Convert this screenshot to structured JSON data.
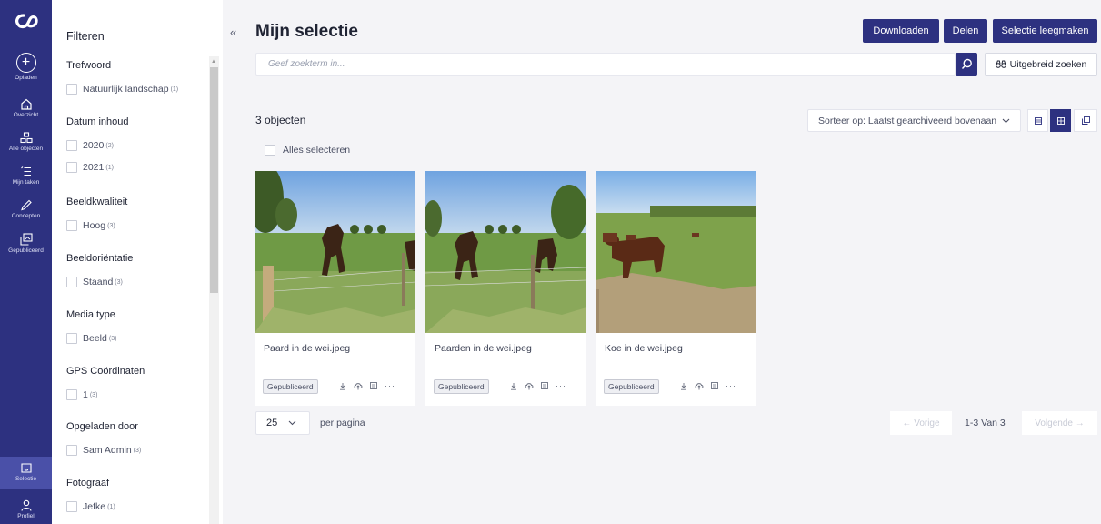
{
  "nav": {
    "upload": "Opladen",
    "overview": "Overzicht",
    "all_objects": "Alle objecten",
    "my_tasks": "Mijn taken",
    "concepts": "Concepten",
    "published": "Gepubliceerd",
    "selection": "Selectie",
    "profile": "Profiel"
  },
  "filters": {
    "title": "Filteren",
    "groups": [
      {
        "title": "Trefwoord",
        "options": [
          {
            "label": "Natuurlijk landschap",
            "count": "(1)"
          }
        ]
      },
      {
        "title": "Datum inhoud",
        "options": [
          {
            "label": "2020",
            "count": "(2)"
          },
          {
            "label": "2021",
            "count": "(1)"
          }
        ]
      },
      {
        "title": "Beeldkwaliteit",
        "options": [
          {
            "label": "Hoog",
            "count": "(3)"
          }
        ]
      },
      {
        "title": "Beeldoriëntatie",
        "options": [
          {
            "label": "Staand",
            "count": "(3)"
          }
        ]
      },
      {
        "title": "Media type",
        "options": [
          {
            "label": "Beeld",
            "count": "(3)"
          }
        ]
      },
      {
        "title": "GPS Coördinaten",
        "options": [
          {
            "label": "1",
            "count": "(3)"
          }
        ]
      },
      {
        "title": "Opgeladen door",
        "options": [
          {
            "label": "Sam Admin",
            "count": "(3)"
          }
        ]
      },
      {
        "title": "Fotograaf",
        "options": [
          {
            "label": "Jefke",
            "count": "(1)"
          }
        ]
      }
    ]
  },
  "header": {
    "title": "Mijn selectie",
    "download": "Downloaden",
    "share": "Delen",
    "clear": "Selectie leegmaken"
  },
  "search": {
    "placeholder": "Geef zoekterm in...",
    "advanced": "Uitgebreid zoeken"
  },
  "results": {
    "count": "3 objecten",
    "select_all": "Alles selecteren",
    "sort": "Sorteer op: Laatst gearchiveerd bovenaan"
  },
  "cards": [
    {
      "name": "Paard in de wei.jpeg",
      "status": "Gepubliceerd"
    },
    {
      "name": "Paarden in de wei.jpeg",
      "status": "Gepubliceerd"
    },
    {
      "name": "Koe in de wei.jpeg",
      "status": "Gepubliceerd"
    }
  ],
  "pagination": {
    "per_page_value": "25",
    "per_page_label": "per pagina",
    "prev": "← Vorige",
    "info": "1-3 Van 3",
    "next": "Volgende →"
  },
  "colors": {
    "brand": "#2d3180",
    "background": "#f4f4f7"
  }
}
